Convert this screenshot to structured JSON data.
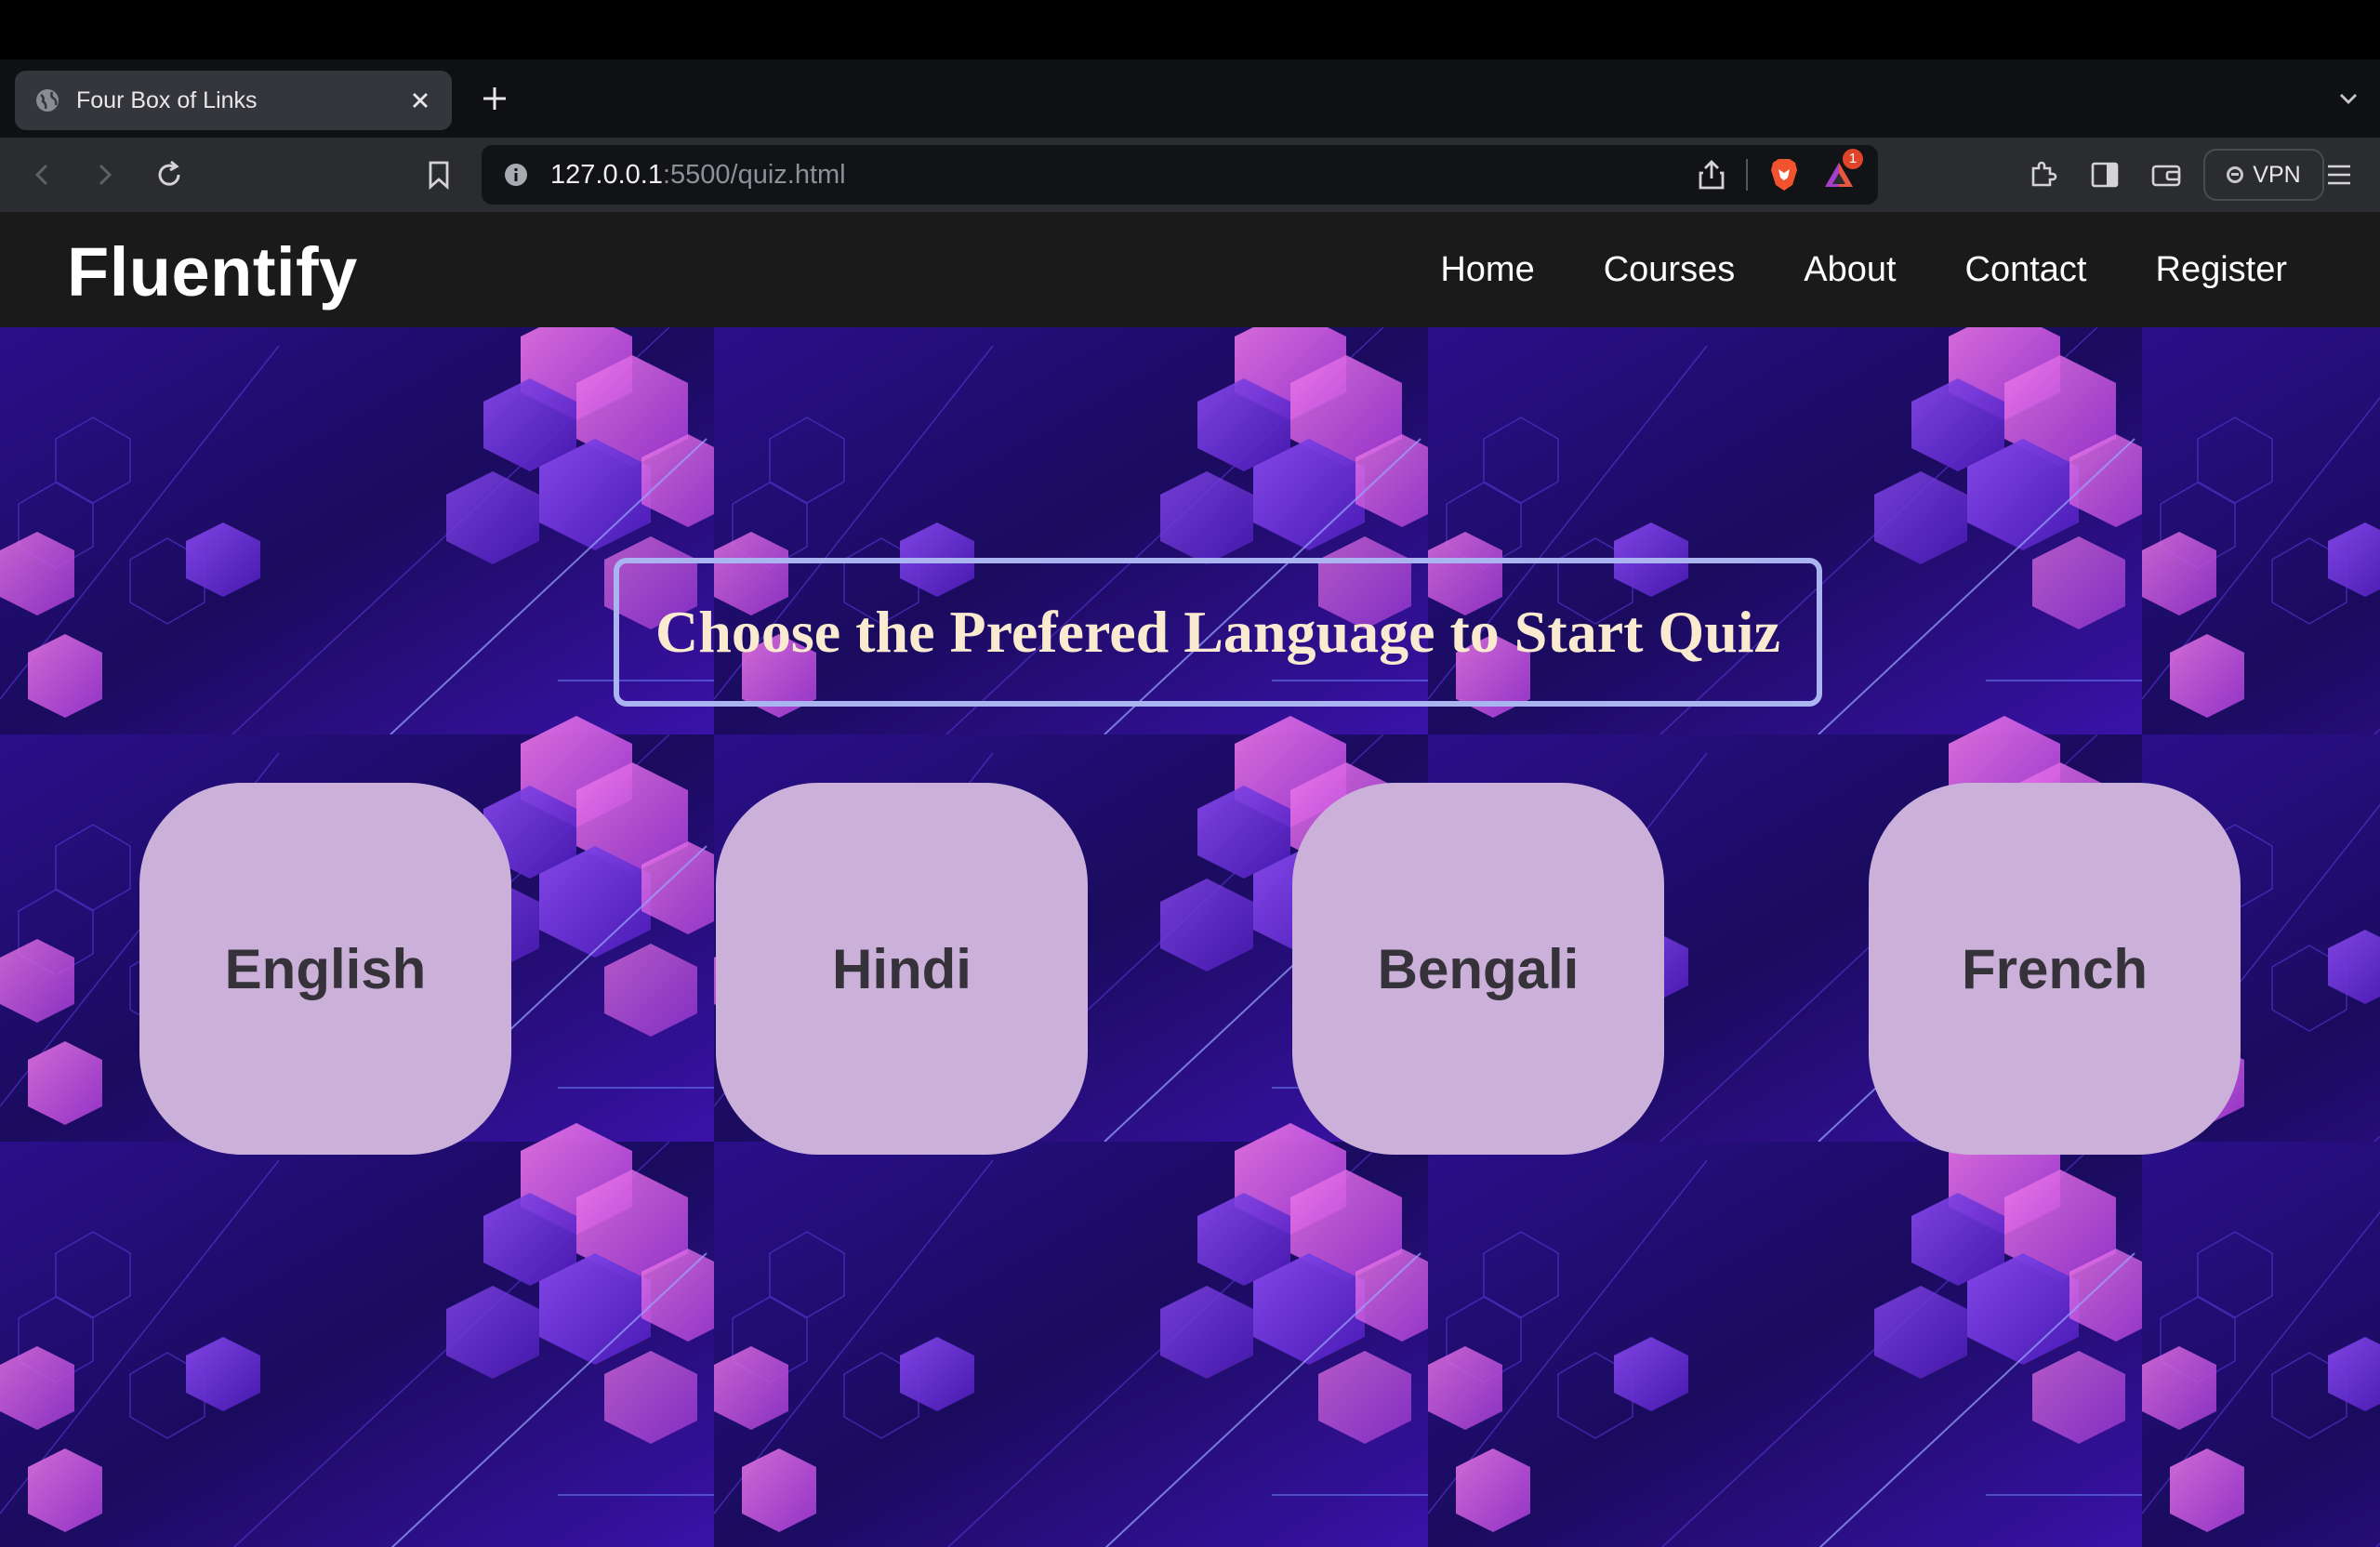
{
  "browser": {
    "tab_title": "Four Box of Links",
    "url_host": "127.0.0.1",
    "url_path": ":5500/quiz.html",
    "notification_count": "1",
    "vpn_label": "VPN"
  },
  "site": {
    "brand": "Fluentify",
    "nav": [
      "Home",
      "Courses",
      "About",
      "Contact",
      "Register"
    ]
  },
  "quiz": {
    "heading": "Choose the Prefered Language to Start Quiz",
    "languages": [
      "English",
      "Hindi",
      "Bengali",
      "French"
    ]
  },
  "colors": {
    "nav_bg": "#1a1a1a",
    "card_bg": "#cbb0da",
    "heading_border": "#a9b4f0",
    "heading_text": "#faebd0",
    "page_bg": "#1f0e6b"
  }
}
